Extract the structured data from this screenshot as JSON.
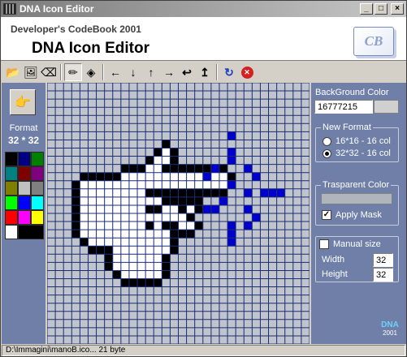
{
  "window": {
    "title": "DNA Icon Editor"
  },
  "banner": {
    "subtitle": "Developer's CodeBook 2001",
    "title": "DNA Icon Editor",
    "logo_text": "CB"
  },
  "toolbar": {
    "buttons": [
      {
        "name": "open-icon",
        "glyph": "📂"
      },
      {
        "name": "image-icon",
        "glyph": "🖼"
      },
      {
        "name": "eraser-icon",
        "glyph": "⌫"
      },
      {
        "name": "pencil-icon",
        "glyph": "✏",
        "pressed": true
      },
      {
        "name": "fill-bucket-icon",
        "glyph": "◈"
      },
      {
        "name": "shift-left-icon",
        "glyph": "←"
      },
      {
        "name": "shift-down-icon",
        "glyph": "↓"
      },
      {
        "name": "shift-up-icon",
        "glyph": "↑"
      },
      {
        "name": "shift-right-icon",
        "glyph": "→"
      },
      {
        "name": "flip-horizontal-icon",
        "glyph": "↩"
      },
      {
        "name": "flip-vertical-icon",
        "glyph": "↥"
      },
      {
        "name": "rotate-icon",
        "glyph": "↻"
      },
      {
        "name": "clear-icon",
        "glyph": "✕"
      }
    ]
  },
  "left_panel": {
    "format_label": "Format",
    "format_value": "32 * 32",
    "palette": [
      "#000000",
      "#000080",
      "#008000",
      "#008080",
      "#800000",
      "#800080",
      "#808000",
      "#c0c0c0",
      "#808080",
      "#00ff00",
      "#0000ff",
      "#00ffff",
      "#ff0000",
      "#ff00ff",
      "#ffff00",
      "#ffffff",
      "#000000"
    ]
  },
  "right_panel": {
    "background_color_label": "BackGround Color",
    "background_color_value": "16777215",
    "new_format_title": "New Format",
    "format_options": [
      {
        "label": "16*16 - 16 col",
        "selected": false
      },
      {
        "label": "32*32 - 16 col",
        "selected": true
      }
    ],
    "transparent_color_title": "Trasparent Color",
    "apply_mask_label": "Apply Mask",
    "apply_mask_checked": true,
    "manual_size_label": "Manual size",
    "manual_size_checked": false,
    "width_label": "Width",
    "width_value": "32",
    "height_label": "Height",
    "height_value": "32",
    "dna_logo_top": "DNA",
    "dna_logo_year": "2001"
  },
  "colors": {
    "outline": "#000000",
    "fill": "#ffffff",
    "sparkle": "#0000cc",
    "grid": "#1c2d74",
    "transparent_cell": "#c0c4cc"
  },
  "status": {
    "text": "D:\\Immagini\\manoB.ico... 21 byte"
  }
}
